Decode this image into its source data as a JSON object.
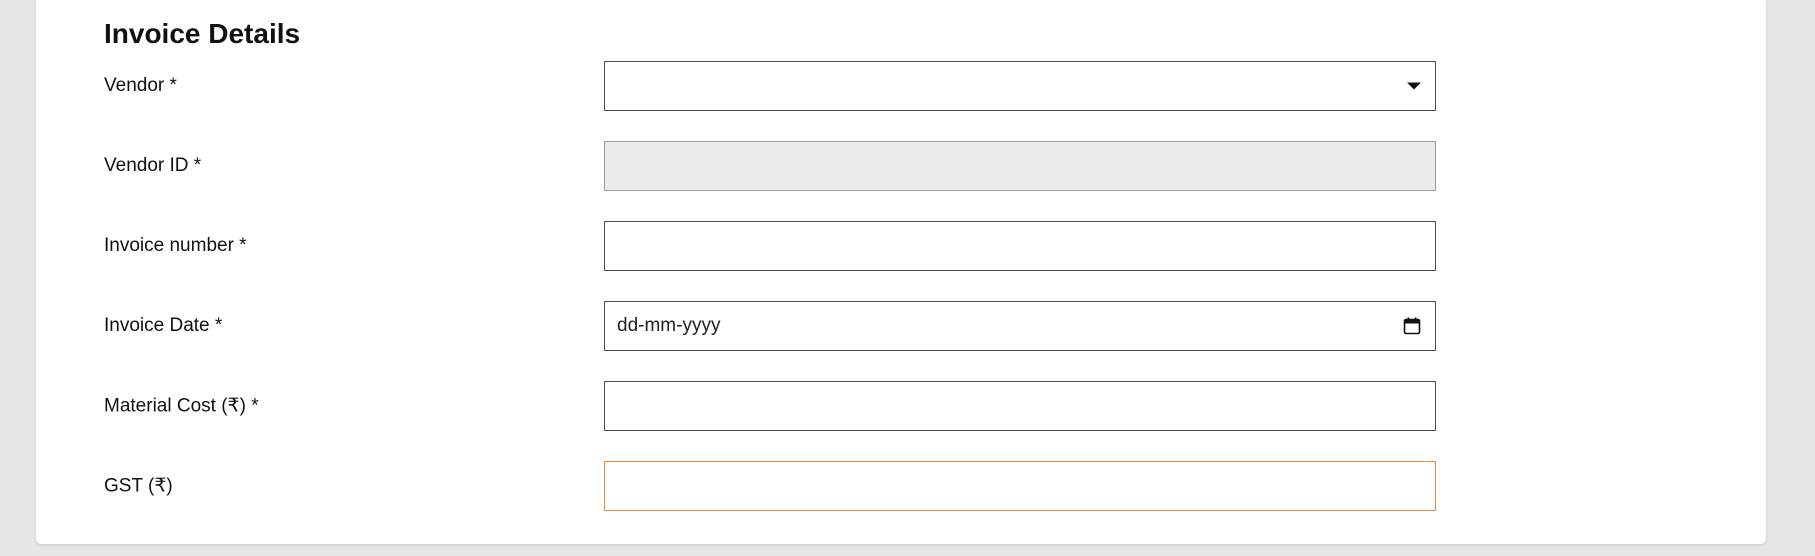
{
  "section": {
    "title": "Invoice Details"
  },
  "fields": {
    "vendor": {
      "label": "Vendor *",
      "value": ""
    },
    "vendor_id": {
      "label": "Vendor ID *",
      "value": ""
    },
    "invoice_number": {
      "label": "Invoice number *",
      "value": ""
    },
    "invoice_date": {
      "label": "Invoice Date *",
      "placeholder": "dd-mm-yyyy"
    },
    "material_cost": {
      "label": "Material Cost (₹) *",
      "value": ""
    },
    "gst": {
      "label": "GST (₹)",
      "value": ""
    }
  },
  "icons": {
    "dropdown": "chevron-down-icon",
    "calendar": "calendar-icon"
  },
  "colors": {
    "focus_border": "#f08a3a",
    "disabled_bg": "#ececec"
  }
}
